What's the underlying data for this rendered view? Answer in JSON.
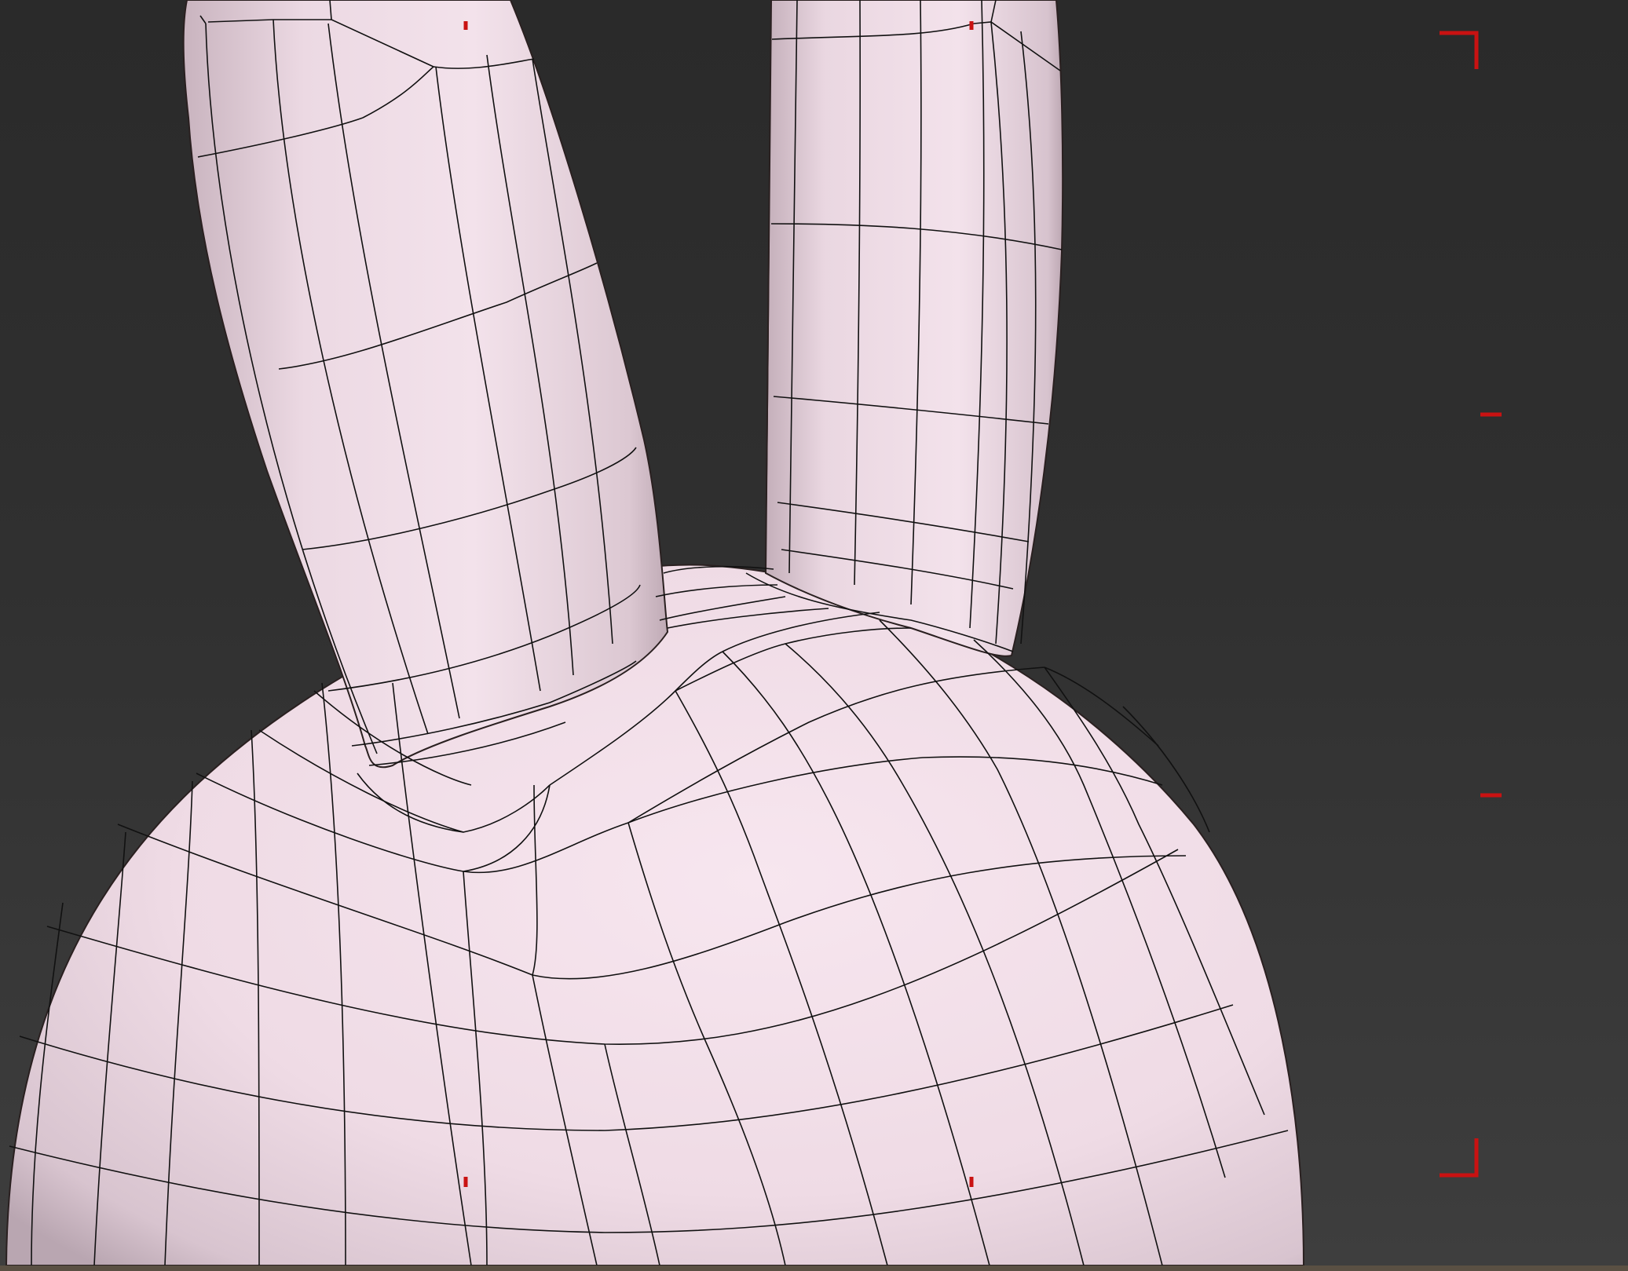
{
  "viewport": {
    "background_top": "#2a2a2a",
    "background_bottom": "#3e3e3e",
    "model_color": "#f2e0ea",
    "model_shade": "#c7b3be",
    "wire_color": "#111111",
    "safe_frame_color": "#cc1111"
  },
  "model": {
    "name": "",
    "parts": [
      "head",
      "left-ear",
      "right-ear"
    ]
  },
  "icons": {
    "safe_frame_corner": "corner-bracket-icon",
    "center_tick": "tick-mark-icon"
  }
}
